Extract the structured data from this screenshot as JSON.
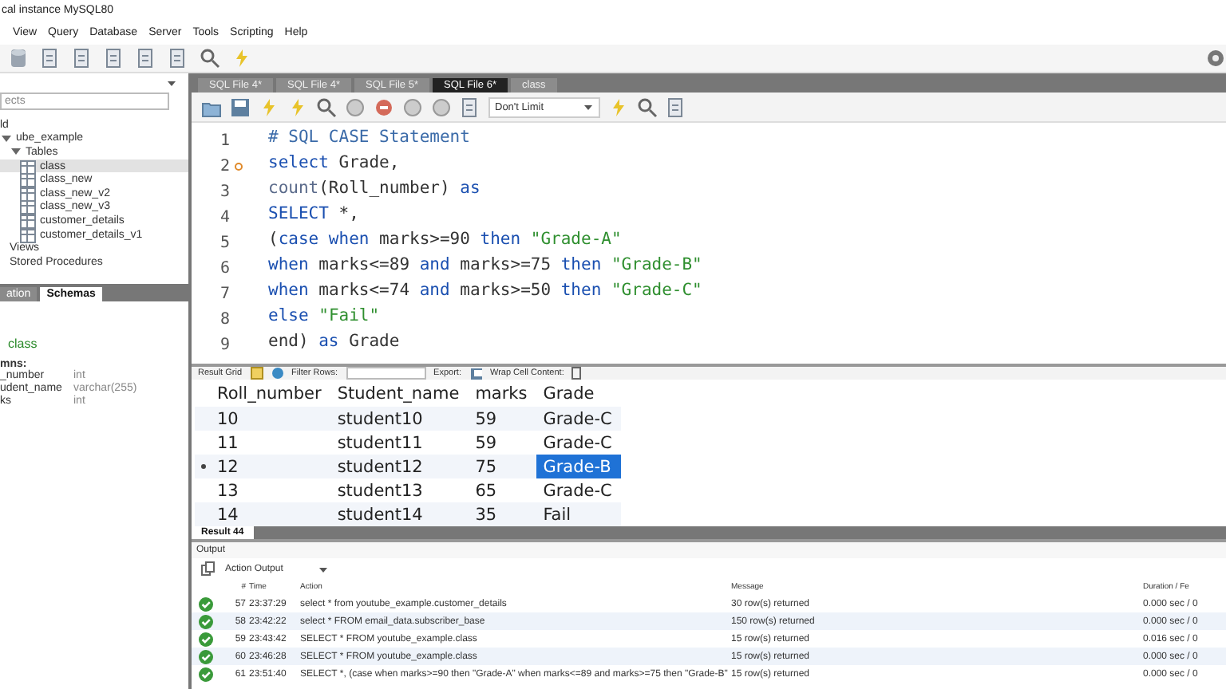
{
  "window": {
    "title": "cal instance MySQL80"
  },
  "menu": [
    "View",
    "Query",
    "Database",
    "Server",
    "Tools",
    "Scripting",
    "Help"
  ],
  "navigator": {
    "search": {
      "placeholder": "ects"
    },
    "tree": [
      {
        "label": "ld",
        "selected": false
      },
      {
        "label": "ube_example",
        "selected": false,
        "expanded": true,
        "children": [
          {
            "label": "Tables",
            "selected": false,
            "expanded": true,
            "children": [
              {
                "label": "class",
                "selected": true
              },
              {
                "label": "class_new",
                "selected": false
              },
              {
                "label": "class_new_v2",
                "selected": false
              },
              {
                "label": "class_new_v3",
                "selected": false
              },
              {
                "label": "customer_details",
                "selected": false
              },
              {
                "label": "customer_details_v1",
                "selected": false
              }
            ]
          },
          {
            "label": "Views",
            "selected": false
          },
          {
            "label": "Stored Procedures",
            "selected": false
          }
        ]
      }
    ],
    "tabs": [
      {
        "label": "ation",
        "selected": false
      },
      {
        "label": "Schemas",
        "selected": true
      }
    ],
    "info": {
      "heading": "class",
      "section": "mns:",
      "columns": [
        {
          "name": "_number",
          "type": "int"
        },
        {
          "name": "udent_name",
          "type": "varchar(255)"
        },
        {
          "name": "ks",
          "type": "int"
        }
      ]
    }
  },
  "editor": {
    "tabs": [
      {
        "label": "SQL File 4*",
        "selected": false
      },
      {
        "label": "SQL File 4*",
        "selected": false
      },
      {
        "label": "SQL File 5*",
        "selected": false
      },
      {
        "label": "SQL File 6*",
        "selected": true
      },
      {
        "label": "class",
        "selected": false
      }
    ],
    "limit": "Don't Limit",
    "lines": [
      {
        "number": "1",
        "marker": false,
        "tokens": [
          {
            "text": "# SQL CASE Statement",
            "kind": "comment"
          }
        ]
      },
      {
        "number": "2",
        "marker": true,
        "tokens": [
          {
            "text": "select",
            "kind": "keyword"
          },
          {
            "text": " Grade,",
            "kind": "plain"
          }
        ]
      },
      {
        "number": "3",
        "marker": false,
        "tokens": [
          {
            "text": "count",
            "kind": "function"
          },
          {
            "text": "(Roll_number) ",
            "kind": "plain"
          },
          {
            "text": "as",
            "kind": "keyword"
          }
        ]
      },
      {
        "number": "4",
        "marker": false,
        "tokens": [
          {
            "text": "SELECT",
            "kind": "keyword"
          },
          {
            "text": " *,",
            "kind": "plain"
          }
        ]
      },
      {
        "number": "5",
        "marker": false,
        "tokens": [
          {
            "text": "(",
            "kind": "plain"
          },
          {
            "text": "case when",
            "kind": "keyword"
          },
          {
            "text": " marks>=90 ",
            "kind": "plain"
          },
          {
            "text": "then",
            "kind": "keyword"
          },
          {
            "text": " \"Grade-A\"",
            "kind": "string"
          }
        ]
      },
      {
        "number": "6",
        "marker": false,
        "tokens": [
          {
            "text": "when",
            "kind": "keyword"
          },
          {
            "text": " marks<=89 ",
            "kind": "plain"
          },
          {
            "text": "and",
            "kind": "keyword"
          },
          {
            "text": " marks>=75 ",
            "kind": "plain"
          },
          {
            "text": "then",
            "kind": "keyword"
          },
          {
            "text": " \"Grade-B\"",
            "kind": "string"
          }
        ]
      },
      {
        "number": "7",
        "marker": false,
        "tokens": [
          {
            "text": "when",
            "kind": "keyword"
          },
          {
            "text": " marks<=74 ",
            "kind": "plain"
          },
          {
            "text": "and",
            "kind": "keyword"
          },
          {
            "text": " marks>=50 ",
            "kind": "plain"
          },
          {
            "text": "then",
            "kind": "keyword"
          },
          {
            "text": " \"Grade-C\"",
            "kind": "string"
          }
        ]
      },
      {
        "number": "8",
        "marker": false,
        "tokens": [
          {
            "text": "else",
            "kind": "keyword"
          },
          {
            "text": " \"Fail\"",
            "kind": "string"
          }
        ]
      },
      {
        "number": "9",
        "marker": false,
        "tokens": [
          {
            "text": "end) ",
            "kind": "plain"
          },
          {
            "text": "as",
            "kind": "keyword"
          },
          {
            "text": " Grade",
            "kind": "plain"
          }
        ]
      }
    ]
  },
  "results": {
    "toolbar": {
      "grid": "Result Grid",
      "filter": "Filter Rows:",
      "export": "Export:",
      "wrap": "Wrap Cell Content:"
    },
    "columns": [
      "Roll_number",
      "Student_name",
      "marks",
      "Grade"
    ],
    "rows": [
      {
        "cells": [
          "10",
          "student10",
          "59",
          "Grade-C"
        ],
        "selected": false
      },
      {
        "cells": [
          "11",
          "student11",
          "59",
          "Grade-C"
        ],
        "selected": false
      },
      {
        "cells": [
          "12",
          "student12",
          "75",
          "Grade-B"
        ],
        "selected": true
      },
      {
        "cells": [
          "13",
          "student13",
          "65",
          "Grade-C"
        ],
        "selected": false
      },
      {
        "cells": [
          "14",
          "student14",
          "35",
          "Fail"
        ],
        "selected": false
      }
    ],
    "tab": "Result 44"
  },
  "output": {
    "title": "Output",
    "mode": "Action Output",
    "columns": [
      "#",
      "Time",
      "Action",
      "Message",
      "Duration / Fe"
    ],
    "rows": [
      {
        "number": "57",
        "time": "23:37:29",
        "action": "select * from youtube_example.customer_details",
        "message": "30 row(s) returned",
        "duration": "0.000 sec / 0"
      },
      {
        "number": "58",
        "time": "23:42:22",
        "action": "select * FROM email_data.subscriber_base",
        "message": "150 row(s) returned",
        "duration": "0.000 sec / 0"
      },
      {
        "number": "59",
        "time": "23:43:42",
        "action": "SELECT * FROM youtube_example.class",
        "message": "15 row(s) returned",
        "duration": "0.016 sec / 0"
      },
      {
        "number": "60",
        "time": "23:46:28",
        "action": "SELECT * FROM youtube_example.class",
        "message": "15 row(s) returned",
        "duration": "0.000 sec / 0"
      },
      {
        "number": "61",
        "time": "23:51:40",
        "action": "SELECT *, (case when marks>=90 then \"Grade-A\" when marks<=89 and marks>=75 then \"Grade-B\"",
        "message": "15 row(s) returned",
        "duration": "0.000 sec / 0"
      }
    ]
  }
}
